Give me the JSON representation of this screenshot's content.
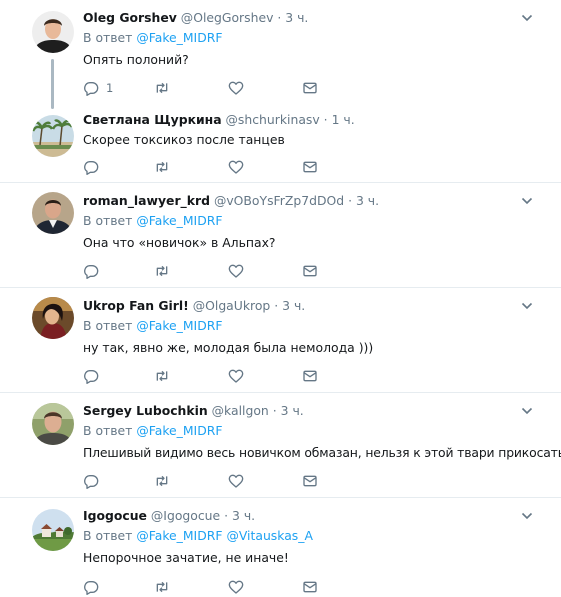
{
  "tweets": [
    {
      "name": "Oleg Gorshev",
      "handle": "@OlegGorshev",
      "time": "3 ч.",
      "reply_prefix": "В ответ",
      "mentions": [
        "@Fake_MIDRF"
      ],
      "text": "Опять полоний?",
      "reply_count": "1",
      "avatar": "man-portrait"
    },
    {
      "name": "Светлана Щуркина",
      "handle": "@shchurkinasv",
      "time": "1 ч.",
      "text": "Скорее токсикоз после танцев",
      "avatar": "palm-trees-landscape"
    },
    {
      "name": "roman_lawyer_krd",
      "handle": "@vOBoYsFrZp7dDOd",
      "time": "3 ч.",
      "reply_prefix": "В ответ",
      "mentions": [
        "@Fake_MIDRF"
      ],
      "text": "Она что «новичок» в Альпах?",
      "avatar": "man-suit-portrait"
    },
    {
      "name": "Ukrop Fan Girl!",
      "handle": "@OlgaUkrop",
      "time": "3 ч.",
      "reply_prefix": "В ответ",
      "mentions": [
        "@Fake_MIDRF"
      ],
      "text": "ну так, явно же, молодая была немолода )))",
      "avatar": "illustrated-woman"
    },
    {
      "name": "Sergey Lubochkin",
      "handle": "@kallgon",
      "time": "3 ч.",
      "reply_prefix": "В ответ",
      "mentions": [
        "@Fake_MIDRF"
      ],
      "text": "Плешивый видимо весь новичком обмазан, нельзя к этой твари прикосаться.",
      "avatar": "man-portrait-outdoor"
    },
    {
      "name": "Igogocue",
      "handle": "@Igogocue",
      "time": "3 ч.",
      "reply_prefix": "В ответ",
      "mentions": [
        "@Fake_MIDRF",
        "@Vitauskas_A"
      ],
      "text": "Непорочное зачатие, не иначе!",
      "avatar": "village-landscape"
    }
  ],
  "separator": "·",
  "colors": {
    "link": "#1da1f2",
    "secondary_text": "#657786",
    "icon": "#657786",
    "divider": "#e6ecf0",
    "thread_line": "#aab8c2"
  },
  "icons": [
    "reply-icon",
    "retweet-icon",
    "like-icon",
    "direct-message-icon",
    "chevron-down-icon"
  ]
}
